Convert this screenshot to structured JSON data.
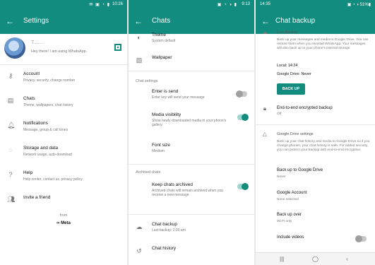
{
  "panel1": {
    "status_time": "10:26",
    "status_icons": "✉ ▣ ◔ ▮",
    "title": "Settings",
    "profile": {
      "name": "T.......",
      "status": "Hey there! I am using WhatsApp."
    },
    "items": [
      {
        "icon": "key-icon",
        "glyph": "⚷",
        "title": "Account",
        "subtitle": "Privacy, security, change number"
      },
      {
        "icon": "chat-icon",
        "glyph": "▤",
        "title": "Chats",
        "subtitle": "Theme, wallpapers, chat history"
      },
      {
        "icon": "bell-icon",
        "glyph": "🔔︎",
        "title": "Notifications",
        "subtitle": "Message, group & call tones"
      },
      {
        "icon": "storage-icon",
        "glyph": "◌",
        "title": "Storage and data",
        "subtitle": "Network usage, auto-download"
      },
      {
        "icon": "help-icon",
        "glyph": "?",
        "title": "Help",
        "subtitle": "Help center, contact us, privacy policy"
      },
      {
        "icon": "people-icon",
        "glyph": "👥︎",
        "title": "Invite a friend",
        "subtitle": ""
      }
    ],
    "from_label": "from",
    "meta_label": "∞ Meta"
  },
  "panel2": {
    "status_time": "9:13",
    "status_icons": "▣ ◔ ◑ ▮",
    "title": "Chats",
    "theme": {
      "title": "Theme",
      "subtitle": "System default"
    },
    "wallpaper": {
      "title": "Wallpaper"
    },
    "chat_settings_header": "Chat settings",
    "enter_is_send": {
      "title": "Enter is send",
      "subtitle": "Enter key will send your message",
      "on": false
    },
    "media_visibility": {
      "title": "Media visibility",
      "subtitle": "Show newly downloaded media in your phone's gallery",
      "on": true
    },
    "font_size": {
      "title": "Font size",
      "subtitle": "Medium"
    },
    "archived_header": "Archived chats",
    "keep_archived": {
      "title": "Keep chats archived",
      "subtitle": "Archived chats will remain archived when you receive a new message",
      "on": true
    },
    "chat_backup": {
      "title": "Chat backup",
      "subtitle": "Last backup: 2:00 am"
    },
    "chat_history": {
      "title": "Chat history"
    }
  },
  "panel3": {
    "status_time": "14:35",
    "status_icons": "▣ ◔ ◑ 51%▮",
    "title": "Chat backup",
    "last_backup": {
      "header": "Last Backup",
      "desc": "Back up your messages and media to Google Drive. You can restore them when you reinstall WhatsApp. Your messages will also back up to your phone's internal storage.",
      "local": "Local: 14:24",
      "gdrive": "Google Drive: Never",
      "button": "BACK UP"
    },
    "e2e": {
      "title": "End-to-end encrypted backup",
      "subtitle": "Off"
    },
    "gdrive_settings": {
      "header": "Google Drive settings",
      "desc": "Back up your chat history and media to Google Drive so if you change phones, your chat history is safe. For added security, you can protect your backup with end-to-end encryption."
    },
    "backup_to_drive": {
      "title": "Back up to Google Drive",
      "subtitle": "Never"
    },
    "google_account": {
      "title": "Google Account",
      "subtitle": "None selected"
    },
    "backup_over": {
      "title": "Back up over",
      "subtitle": "Wi-Fi only"
    },
    "include_videos": {
      "title": "Include videos",
      "on": false
    },
    "navbar": {
      "recents": "|||",
      "home": "◯",
      "back": "‹"
    }
  }
}
